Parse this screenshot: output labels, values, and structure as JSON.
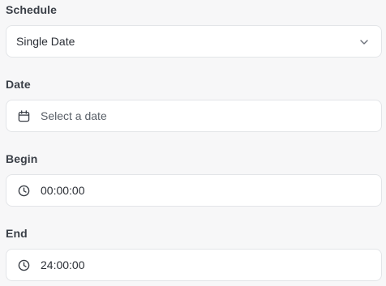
{
  "schedule": {
    "label": "Schedule",
    "value": "Single Date",
    "icon": "chevron-down-icon"
  },
  "date": {
    "label": "Date",
    "placeholder": "Select a date",
    "icon": "calendar-icon"
  },
  "begin": {
    "label": "Begin",
    "value": "00:00:00",
    "icon": "clock-icon"
  },
  "end": {
    "label": "End",
    "value": "24:00:00",
    "icon": "clock-icon"
  }
}
